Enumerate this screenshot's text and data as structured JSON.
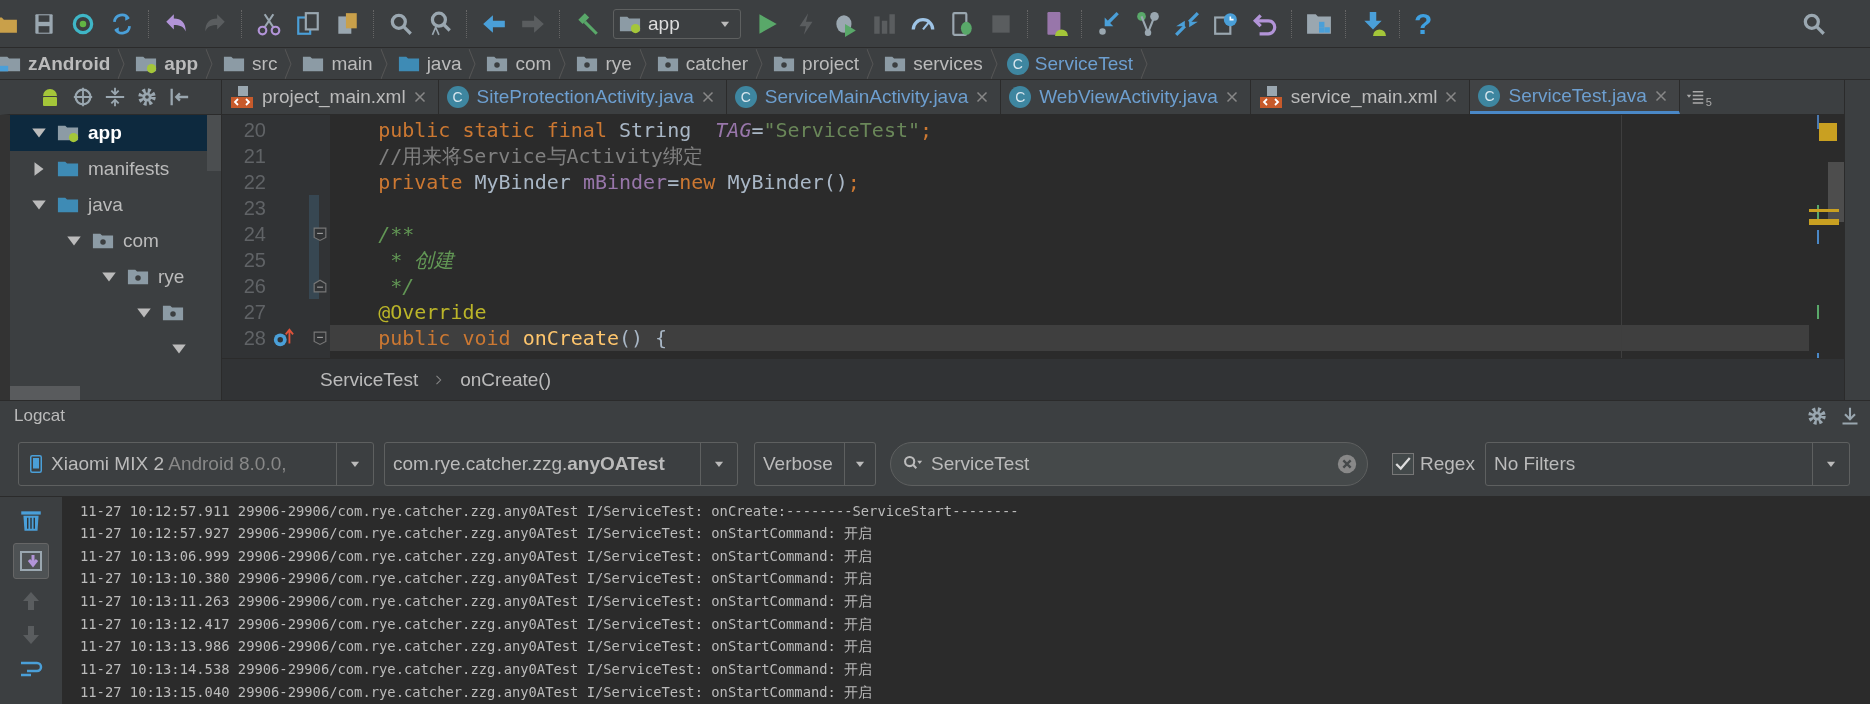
{
  "toolbar": {
    "run_config": "app",
    "help": "?"
  },
  "navigation_bar": [
    {
      "label": "zAndroid",
      "kind": "project"
    },
    {
      "label": "app",
      "kind": "module"
    },
    {
      "label": "src",
      "kind": "folder"
    },
    {
      "label": "main",
      "kind": "folder"
    },
    {
      "label": "java",
      "kind": "source"
    },
    {
      "label": "com",
      "kind": "package"
    },
    {
      "label": "rye",
      "kind": "package"
    },
    {
      "label": "catcher",
      "kind": "package"
    },
    {
      "label": "project",
      "kind": "package"
    },
    {
      "label": "services",
      "kind": "package"
    },
    {
      "label": "ServiceTest",
      "kind": "class",
      "badge": "C"
    }
  ],
  "project_tree": [
    {
      "label": "app",
      "kind": "module",
      "expanded": true,
      "selected": true,
      "children": [
        {
          "label": "manifests",
          "kind": "source",
          "expanded": false,
          "selected": false
        },
        {
          "label": "java",
          "kind": "source",
          "expanded": true,
          "selected": false,
          "children": [
            {
              "label": "com",
              "kind": "package",
              "expanded": true,
              "selected": false,
              "children": [
                {
                  "label": "rye",
                  "kind": "package",
                  "expanded": true,
                  "selected": false,
                  "children": [
                    {
                      "kind": "package",
                      "expanded": true,
                      "selected": false,
                      "children": [
                        {
                          "expanded": true,
                          "selected": false
                        }
                      ]
                    }
                  ]
                }
              ]
            }
          ]
        }
      ]
    }
  ],
  "tabs": [
    {
      "label": "project_main.xml",
      "kind": "xml",
      "selected": false
    },
    {
      "label": "SiteProtectionActivity.java",
      "kind": "java",
      "badge": "C",
      "selected": false
    },
    {
      "label": "ServiceMainActivity.java",
      "kind": "java",
      "badge": "C",
      "selected": false
    },
    {
      "label": "WebViewActivity.java",
      "kind": "java",
      "badge": "C",
      "selected": false
    },
    {
      "label": "service_main.xml",
      "kind": "xml",
      "selected": false
    },
    {
      "label": "ServiceTest.java",
      "kind": "java",
      "badge": "C",
      "selected": true
    }
  ],
  "tab_overflow": {
    "count": "5"
  },
  "editor": {
    "lines": [
      {
        "number": "20",
        "current": false,
        "changed": false,
        "override": false,
        "tokens": [
          {
            "kind": "kw",
            "text": "    public static final "
          },
          {
            "kind": "plain",
            "text": "String  "
          },
          {
            "kind": "static",
            "text": "TAG"
          },
          {
            "kind": "plain",
            "text": "="
          },
          {
            "kind": "str",
            "text": "\"ServiceTest\""
          },
          {
            "kind": "kw",
            "text": ";"
          }
        ]
      },
      {
        "number": "21",
        "current": false,
        "changed": false,
        "override": false,
        "tokens": [
          {
            "kind": "comment",
            "text": "    //用来将Service与Activity绑定"
          }
        ]
      },
      {
        "number": "22",
        "current": false,
        "changed": false,
        "override": false,
        "tokens": [
          {
            "kind": "kw",
            "text": "    private "
          },
          {
            "kind": "plain",
            "text": "MyBinder "
          },
          {
            "kind": "field",
            "text": "mBinder"
          },
          {
            "kind": "plain",
            "text": "="
          },
          {
            "kind": "kw",
            "text": "new "
          },
          {
            "kind": "plain",
            "text": "MyBinder()"
          },
          {
            "kind": "kw",
            "text": ";"
          }
        ]
      },
      {
        "number": "23",
        "current": false,
        "changed": true,
        "override": false
      },
      {
        "number": "24",
        "current": false,
        "changed": true,
        "override": false,
        "fold_start": true,
        "fold_end": false,
        "tokens": [
          {
            "kind": "doc",
            "text": "    /**"
          }
        ]
      },
      {
        "number": "25",
        "current": false,
        "changed": true,
        "override": false,
        "tokens": [
          {
            "kind": "doc",
            "text": "     * 创建"
          }
        ]
      },
      {
        "number": "26",
        "current": false,
        "changed": true,
        "override": false,
        "fold_start": false,
        "fold_end": true,
        "tokens": [
          {
            "kind": "doc",
            "text": "     */"
          }
        ]
      },
      {
        "number": "27",
        "current": false,
        "changed": false,
        "override": false,
        "tokens": [
          {
            "kind": "annotation",
            "text": "    @Override"
          }
        ]
      },
      {
        "number": "28",
        "current": true,
        "changed": false,
        "override": true,
        "fold_start": true,
        "fold_end": false,
        "tokens": [
          {
            "kind": "kw",
            "text": "    public void "
          },
          {
            "kind": "method",
            "text": "onCreate"
          },
          {
            "kind": "plain",
            "text": "() {"
          }
        ]
      }
    ],
    "breadcrumbs": [
      "ServiceTest",
      "onCreate()"
    ]
  },
  "logcat": {
    "title": "Logcat",
    "device": {
      "name": "Xiaomi MIX 2",
      "detail": "Android 8.0.0,"
    },
    "process": "com.rye.catcher.zzg.**anyOATest**",
    "level": "Verbose",
    "search": {
      "value": "ServiceTest"
    },
    "regex": {
      "label": "Regex",
      "checked": true
    },
    "filter": "No Filters",
    "scroll_to_end": true,
    "lines": [
      "11-27 10:12:57.911 29906-29906/com.rye.catcher.zzg.any0ATest I/ServiceTest: onCreate:--------ServiceStart--------",
      "11-27 10:12:57.927 29906-29906/com.rye.catcher.zzg.any0ATest I/ServiceTest: onStartCommand: 开启",
      "11-27 10:13:06.999 29906-29906/com.rye.catcher.zzg.any0ATest I/ServiceTest: onStartCommand: 开启",
      "11-27 10:13:10.380 29906-29906/com.rye.catcher.zzg.any0ATest I/ServiceTest: onStartCommand: 开启",
      "11-27 10:13:11.263 29906-29906/com.rye.catcher.zzg.any0ATest I/ServiceTest: onStartCommand: 开启",
      "11-27 10:13:12.417 29906-29906/com.rye.catcher.zzg.any0ATest I/ServiceTest: onStartCommand: 开启",
      "11-27 10:13:13.986 29906-29906/com.rye.catcher.zzg.any0ATest I/ServiceTest: onStartCommand: 开启",
      "11-27 10:13:14.538 29906-29906/com.rye.catcher.zzg.any0ATest I/ServiceTest: onStartCommand: 开启",
      "11-27 10:13:15.040 29906-29906/com.rye.catcher.zzg.any0ATest I/ServiceTest: onStartCommand: 开启"
    ]
  }
}
